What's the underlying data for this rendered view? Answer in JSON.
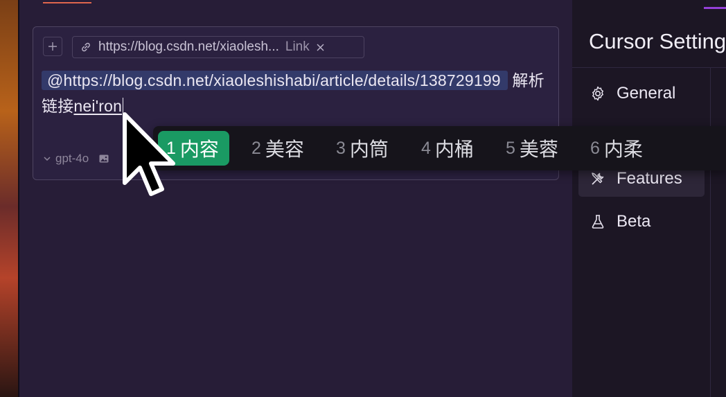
{
  "composer": {
    "link_chip": {
      "url": "https://blog.csdn.net/xiaolesh...",
      "kind": "Link"
    },
    "prompt": {
      "mention": "@https://blog.csdn.net/xiaoleshishabi/article/details/138729199",
      "text": "解析链接",
      "composing": "nei'ron"
    },
    "model": "gpt-4o"
  },
  "ime": {
    "candidates": [
      {
        "num": "1",
        "text": "内容"
      },
      {
        "num": "2",
        "text": "美容"
      },
      {
        "num": "3",
        "text": "内筒"
      },
      {
        "num": "4",
        "text": "内桶"
      },
      {
        "num": "5",
        "text": "美蓉"
      },
      {
        "num": "6",
        "text": "内柔"
      }
    ],
    "selected": "1"
  },
  "settings": {
    "title": "Cursor Settings",
    "nav": [
      {
        "label": "General",
        "icon": "gear-icon"
      },
      {
        "label": "Features",
        "icon": "tools-icon"
      },
      {
        "label": "Beta",
        "icon": "flask-icon"
      }
    ],
    "active": "Features"
  },
  "colors": {
    "background": "#271d37",
    "accent": "#e0664d",
    "ime_selected": "#1a9a63",
    "mention_bg": "#333a6a"
  }
}
